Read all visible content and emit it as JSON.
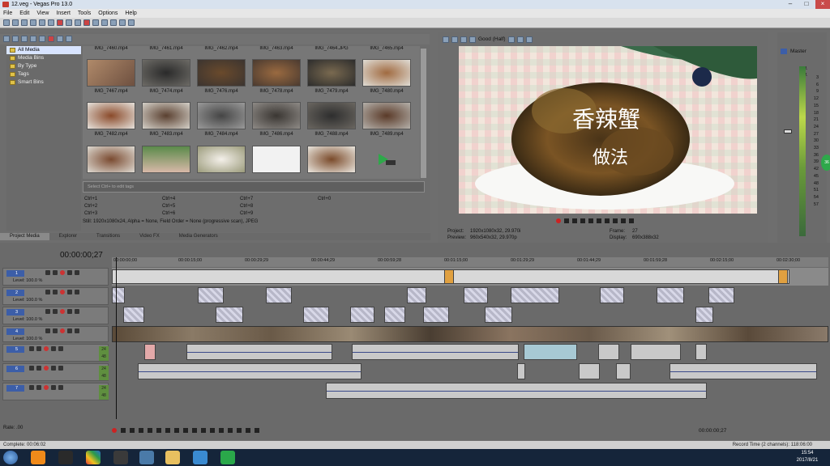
{
  "window": {
    "title": "12.veg - Vegas Pro 13.0"
  },
  "menu": [
    "File",
    "Edit",
    "View",
    "Insert",
    "Tools",
    "Options",
    "Help"
  ],
  "tree": {
    "items": [
      "All Media",
      "Media Bins",
      "By Type",
      "Tags",
      "Smart Bins"
    ]
  },
  "thumbs": {
    "top_labels": [
      "IMG_7460.mp4",
      "IMG_7461.mp4",
      "IMG_7462.mp4",
      "IMG_7463.mp4",
      "IMG_7464.JPG",
      "IMG_7465.mp4"
    ],
    "row1": [
      "IMG_7467.mp4",
      "IMG_7474.mp4",
      "IMG_7476.mp4",
      "IMG_7478.mp4",
      "IMG_7479.mp4",
      "IMG_7480.mp4"
    ],
    "row2": [
      "IMG_7482.mp4",
      "IMG_7483.mp4",
      "IMG_7484.mp4",
      "IMG_7486.mp4",
      "IMG_7488.mp4",
      "IMG_7489.mp4"
    ]
  },
  "tag_placeholder": "Select Ctrl+ to edit tags",
  "tag_shortcuts": [
    "Ctrl+1",
    "Ctrl+4",
    "Ctrl+7",
    "Ctrl+0",
    "Ctrl+2",
    "Ctrl+5",
    "Ctrl+8",
    "Ctrl+3",
    "Ctrl+6",
    "Ctrl+9"
  ],
  "media_info": "Still: 1920x1080x24, Alpha = None, Field Order = None (progressive scan), JPEG",
  "tabs": [
    "Project Media",
    "Explorer",
    "Transitions",
    "Video FX",
    "Media Generators"
  ],
  "preview": {
    "quality": "Good (Half)",
    "title_text": "香辣蟹",
    "subtitle_text": "做法",
    "project_label": "Project:",
    "project_value": "1920x1080x32, 29.970i",
    "preview_label": "Preview:",
    "preview_value": "960x540x32, 29.970p",
    "frame_label": "Frame:",
    "frame_value": "27",
    "display_label": "Display:",
    "display_value": "690x388x32"
  },
  "master": {
    "label": "Master",
    "peak_left": "-Inf.",
    "peak_right": "-Inf.",
    "scale": [
      "3",
      "6",
      "9",
      "12",
      "15",
      "18",
      "21",
      "24",
      "27",
      "30",
      "33",
      "36",
      "39",
      "42",
      "45",
      "48",
      "51",
      "54",
      "57"
    ],
    "side_value": "36"
  },
  "timeline": {
    "timecode": "00:00:00;27",
    "ruler": [
      "00:00:00;00",
      "00:00:15;00",
      "00:00:29;29",
      "00:00:44;29",
      "00:00:59;28",
      "00:01:15;00",
      "00:01:29;29",
      "00:01:44;29",
      "00:01:59;28",
      "00:02:15;00",
      "00:02:30;00"
    ],
    "video_tracks": [
      {
        "num": "1",
        "level": "Level: 100.0 %"
      },
      {
        "num": "2",
        "level": "Level: 100.0 %"
      },
      {
        "num": "3",
        "level": "Level: 100.0 %"
      },
      {
        "num": "4",
        "level": "Level: 100.0 %"
      }
    ],
    "audio_tracks": [
      {
        "num": "5",
        "tag": "24 48"
      },
      {
        "num": "6",
        "tag": "24 48"
      },
      {
        "num": "7",
        "tag": "24 48"
      }
    ]
  },
  "transport": {
    "rate": "Rate: .00",
    "timecode": "00:00:00;27"
  },
  "status": {
    "complete": "Complete: 00:06:02",
    "record_time": "Record Time (2 channels): 118:06:00"
  },
  "clock": {
    "time": "15:54",
    "date": "2017/8/21"
  }
}
